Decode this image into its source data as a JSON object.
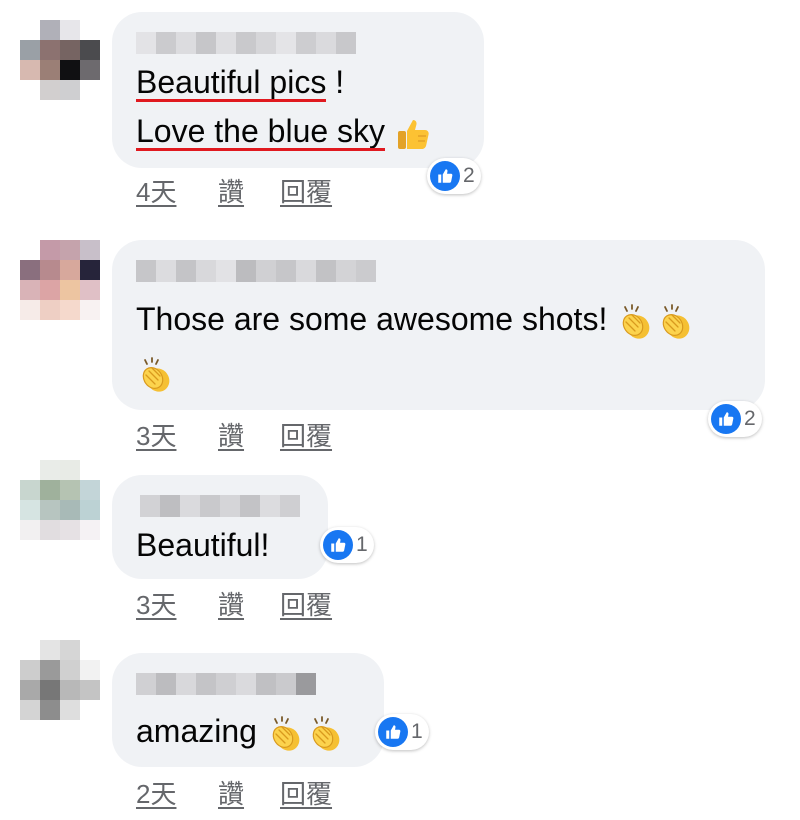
{
  "comments": [
    {
      "lines": [
        {
          "main": "Beautiful pics",
          "tail": " !"
        },
        {
          "main": "Love the blue sky",
          "tail": " "
        }
      ],
      "emoji": "thumbs-up-icon",
      "reaction_count": "2",
      "time": "4天",
      "like_label": "讚",
      "reply_label": "回覆"
    },
    {
      "line1": "Those are some awesome shots! ",
      "emoji": "clapping-hands-icon",
      "reaction_count": "2",
      "time": "3天",
      "like_label": "讚",
      "reply_label": "回覆"
    },
    {
      "line1": "Beautiful!",
      "reaction_count": "1",
      "time": "3天",
      "like_label": "讚",
      "reply_label": "回覆"
    },
    {
      "line1": "amazing ",
      "emoji": "clapping-hands-icon",
      "reaction_count": "1",
      "time": "2天",
      "like_label": "讚",
      "reply_label": "回覆"
    }
  ],
  "colors": {
    "bubble": "#f0f2f5",
    "like_blue": "#1877f2",
    "highlight_underline": "#e0191f",
    "meta_text": "#65676b"
  }
}
